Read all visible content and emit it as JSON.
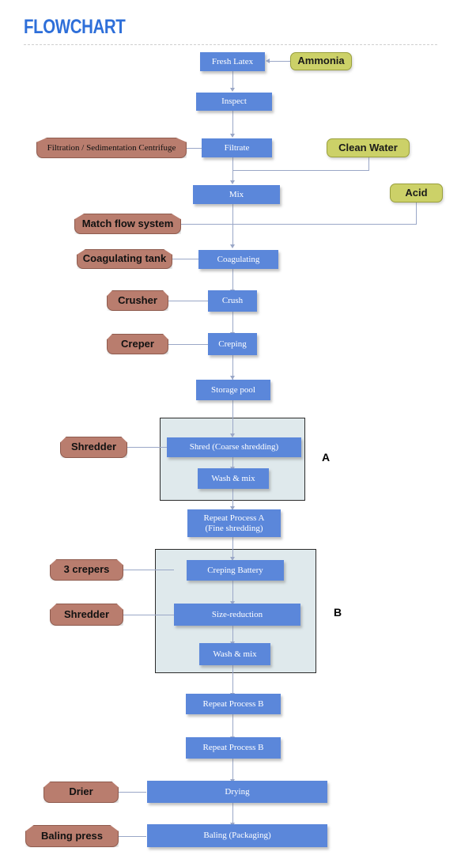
{
  "header": {
    "title": "FLOWCHART",
    "title_color": "#2e6fd9"
  },
  "palette": {
    "process_blue": "#5b87da",
    "material_olive": "#ccd168",
    "equipment_brown": "#b97d6e",
    "group_fill": "#dfe9ec",
    "connector": "#9aa7c7"
  },
  "groups": [
    {
      "id": "A",
      "label": "A"
    },
    {
      "id": "B",
      "label": "B"
    }
  ],
  "process_nodes": [
    {
      "id": "fresh_latex",
      "label": "Fresh Latex"
    },
    {
      "id": "inspect",
      "label": "Inspect"
    },
    {
      "id": "filtrate",
      "label": "Filtrate"
    },
    {
      "id": "mix",
      "label": "Mix"
    },
    {
      "id": "coagulating",
      "label": "Coagulating"
    },
    {
      "id": "crush",
      "label": "Crush"
    },
    {
      "id": "creping",
      "label": "Creping"
    },
    {
      "id": "storage_pool",
      "label": "Storage pool"
    },
    {
      "id": "shred_coarse",
      "label": "Shred (Coarse shredding)"
    },
    {
      "id": "wash_mix_a",
      "label": "Wash & mix"
    },
    {
      "id": "repeat_a",
      "label": "Repeat Process A"
    },
    {
      "id": "repeat_a_sub",
      "label": "(Fine shredding)"
    },
    {
      "id": "creping_battery",
      "label": "Creping Battery"
    },
    {
      "id": "size_reduction",
      "label": "Size-reduction"
    },
    {
      "id": "wash_mix_b",
      "label": "Wash & mix"
    },
    {
      "id": "repeat_b_1",
      "label": "Repeat Process B"
    },
    {
      "id": "repeat_b_2",
      "label": "Repeat Process B"
    },
    {
      "id": "drying",
      "label": "Drying"
    },
    {
      "id": "baling",
      "label": "Baling (Packaging)"
    }
  ],
  "material_nodes": [
    {
      "id": "ammonia",
      "label": "Ammonia"
    },
    {
      "id": "clean_water",
      "label": "Clean Water"
    },
    {
      "id": "acid",
      "label": "Acid"
    }
  ],
  "equipment_nodes": [
    {
      "id": "filtration_centrifuge",
      "label": "Filtration / Sedimentation Centrifuge"
    },
    {
      "id": "match_flow_system",
      "label": "Match flow system"
    },
    {
      "id": "coagulating_tank",
      "label": "Coagulating tank"
    },
    {
      "id": "crusher",
      "label": "Crusher"
    },
    {
      "id": "creper",
      "label": "Creper"
    },
    {
      "id": "shredder_a",
      "label": "Shredder"
    },
    {
      "id": "three_crepers",
      "label": "3 crepers"
    },
    {
      "id": "shredder_b",
      "label": "Shredder"
    },
    {
      "id": "drier",
      "label": "Drier"
    },
    {
      "id": "baling_press",
      "label": "Baling press"
    }
  ]
}
